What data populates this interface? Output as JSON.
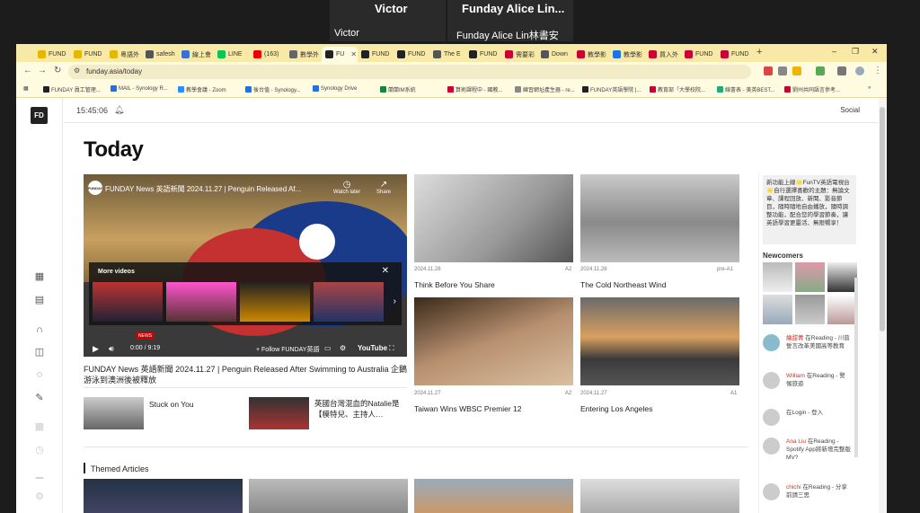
{
  "zoom": {
    "tile1_name_big": "Victor",
    "tile1_name_small": "Victor",
    "tile2_name_big": "Funday Alice Lin...",
    "tile2_name_small": "Funday Alice Lin林書安",
    "more": "•••"
  },
  "browser": {
    "tabs": [
      {
        "label": "FUND",
        "color": "#e4b800"
      },
      {
        "label": "FUND",
        "color": "#e4b800"
      },
      {
        "label": "粵語外",
        "color": "#e4b800"
      },
      {
        "label": "safesh",
        "color": "#555"
      },
      {
        "label": "線上會",
        "color": "#3b6fd4"
      },
      {
        "label": "LINE",
        "color": "#06c755"
      },
      {
        "label": "(163)",
        "color": "#e00"
      },
      {
        "label": "數學外",
        "color": "#666"
      },
      {
        "label": "FU",
        "color": "#222"
      },
      {
        "label": "FUND",
        "color": "#222"
      },
      {
        "label": "FUND",
        "color": "#222"
      },
      {
        "label": "The E",
        "color": "#555"
      },
      {
        "label": "FUND",
        "color": "#222"
      },
      {
        "label": "需要彩",
        "color": "#c03"
      },
      {
        "label": "Down",
        "color": "#555"
      },
      {
        "label": "教學影",
        "color": "#c03"
      },
      {
        "label": "教學影",
        "color": "#1a73e8"
      },
      {
        "label": "買入外",
        "color": "#c03"
      },
      {
        "label": "FUND",
        "color": "#c03"
      },
      {
        "label": "FUND",
        "color": "#c03"
      }
    ],
    "active_tab_index": 8,
    "new_tab": "+",
    "win_minimize": "–",
    "win_restore": "❐",
    "win_close": "✕",
    "url": "funday.asia/today",
    "bookmarks": [
      "FUNDAY 員工管理...",
      "MAIL - Synology R...",
      "教學會議 - Zoom",
      "後台值 - Synology...",
      "Synology Drive",
      "蘭蘭IM系統",
      "算術課程中 - 國教...",
      "練習網址產生器 - re...",
      "FUNDAY英語學院 |...",
      "教育部「大學校院...",
      "線書表 - 美英BEST...",
      "劉州共同語言參考..."
    ]
  },
  "page": {
    "logo": "FD",
    "clock": "15:45:06",
    "social": "Social",
    "heading": "Today",
    "video": {
      "channel": "FUNDAY",
      "title": "FUNDAY News 英語新聞 2024.11.27 | Penguin Released Af...",
      "watch_later": "Watch later",
      "share": "Share",
      "more_videos": "More videos",
      "time": "0:00 / 9:19",
      "follow": "+ Follow FUNDAY英語",
      "brand": "YouTube",
      "news_tag": "NEWS",
      "caption": "FUNDAY News 英語新聞 2024.11.27 | Penguin Released After Swimming to Australia 企鵝游泳到澳洲後被釋放"
    },
    "cards": [
      {
        "date": "2024.11.28",
        "level": "A2",
        "title": "Think Before You Share"
      },
      {
        "date": "2024.11.28",
        "level": "pre-A1",
        "title": "The Cold Northeast Wind"
      },
      {
        "date": "2024.11.27",
        "level": "A2",
        "title": "Taiwan Wins WBSC Premier 12"
      },
      {
        "date": "2024.11.27",
        "level": "A1",
        "title": "Entering Los Angeles"
      }
    ],
    "small_items": [
      {
        "title": "Stuck on You"
      },
      {
        "title": "英國台灣混血的Natalie是 【模特兒、主持人…"
      }
    ],
    "section": "Themed Articles",
    "side": {
      "promo": "新功能上線🌟FunTV英語電視台🌟自行選擇喜歡的主題：無論文章、課程回放、新聞、影音節目，隨時隨地自由播放，隨時調整功能，配合您的學習節奏，讓英語學習更靈活、無限暢享！",
      "newcomers": "Newcomers",
      "activity": [
        {
          "user": "繪甜菁",
          "text": " 在Reading - 川普誓言改革美國高等教育"
        },
        {
          "user": "William",
          "text": " 在Reading - 警惕旅遊"
        },
        {
          "user": "",
          "text": "在Login - 登入"
        },
        {
          "user": "Ana Liu",
          "text": " 在Reading - Spotify App將新增完整版MV?"
        },
        {
          "user": "chichi",
          "text": " 在Reading - 分享前請三思"
        }
      ]
    }
  }
}
